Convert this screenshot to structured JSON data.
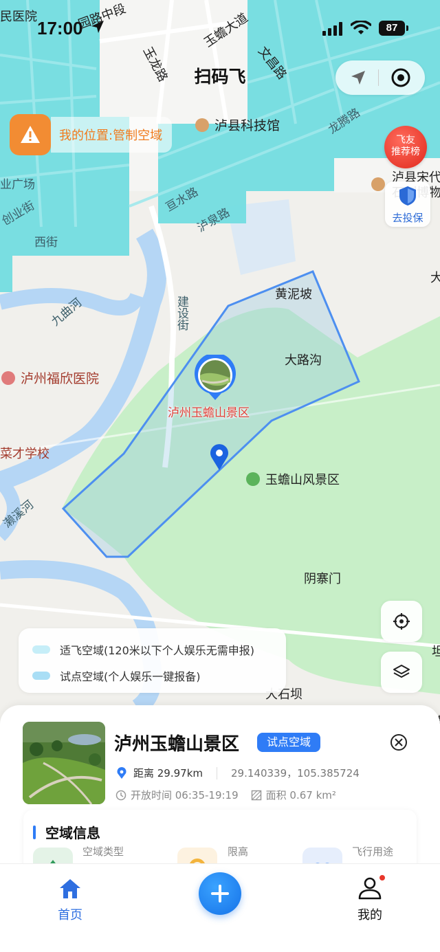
{
  "status_bar": {
    "time": "17:00",
    "battery": "87"
  },
  "header": {
    "title": "扫码飞"
  },
  "my_location": {
    "text": "我的位置:管制空域"
  },
  "rank_badge": {
    "line1": "飞友",
    "line2": "推荐榜"
  },
  "insure": {
    "label": "去投保"
  },
  "map": {
    "labels": {
      "hospital_top": "民医院",
      "yuchan_road": "玉蟾大道",
      "wenchang_road": "文昌路",
      "yulong_road": "玉龙路",
      "zhongduan_road": "园路中段",
      "kejiguan": "泸县科技馆",
      "longteng_road": "龙腾路",
      "guangchang": "业广场",
      "chuangye_street": "创业街",
      "xi_street": "西街",
      "genshui_road": "亘水路",
      "luquan_road": "泸泉路",
      "songdai_museum1": "泸县宋代",
      "songdai_museum2": "石刻博物",
      "huangnipo": "黄泥坡",
      "jianshe_street": "建设街",
      "jiuqu_river": "九曲河",
      "dalugou": "大路沟",
      "fuxin_hospital": "泸州福欣医院",
      "yuchanshan_scenic_poi": "玉蟾山风景区",
      "rencai_school": "菜才学校",
      "laixi_river": "濑溪河",
      "yinzhaimen": "阴寨门",
      "dashiba": "大石坝",
      "edge_da": "大",
      "edge_ba": "坦",
      "edge_dong": "東"
    }
  },
  "pin": {
    "label": "泸州玉蟾山景区"
  },
  "legend": {
    "items": [
      {
        "label": "适飞空域(120米以下个人娱乐无需申报)",
        "color": "#c6eef8"
      },
      {
        "label": "试点空域(个人娱乐一键报备)",
        "color": "#a9def5"
      }
    ]
  },
  "sheet": {
    "name": "泸州玉蟾山景区",
    "tag": "试点空域",
    "distance": "距离 29.97km",
    "coords": "29.140339，105.385724",
    "open_time": "开放时间 06:35-19:19",
    "area": "面积 0.67 km²",
    "airspace_title": "空域信息",
    "airspace_type_label": "空域类型",
    "height_limit_label": "限高",
    "usage_label": "飞行用途"
  },
  "tabs": {
    "home": "首页",
    "me": "我的"
  },
  "colors": {
    "accent": "#2f7cf6",
    "warning": "#f28c33",
    "airspace_cyan": "#6fdce0"
  }
}
